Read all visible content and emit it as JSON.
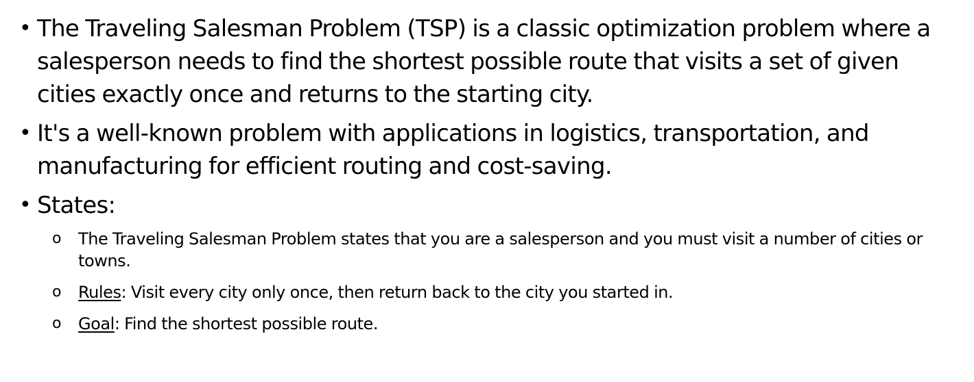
{
  "bullets": [
    {
      "marker": "•",
      "text": "The Traveling Salesman Problem (TSP) is a classic optimization problem where a salesperson needs to find the shortest possible route that visits a set of given cities exactly once and returns to the starting city."
    },
    {
      "marker": "•",
      "text": "It's a well-known problem with applications in logistics, transportation, and manufacturing for efficient routing and cost-saving."
    },
    {
      "marker": "•",
      "text": "States:"
    }
  ],
  "sub_bullets": [
    {
      "marker": "o",
      "text": "The Traveling Salesman Problem states that you are a salesperson and you must visit a number of cities or towns."
    },
    {
      "marker": "o",
      "label": "Rules",
      "text": ": Visit every city only once, then return back to the city you started in."
    },
    {
      "marker": "o",
      "label": "Goal",
      "text": ": Find the shortest possible route."
    }
  ]
}
